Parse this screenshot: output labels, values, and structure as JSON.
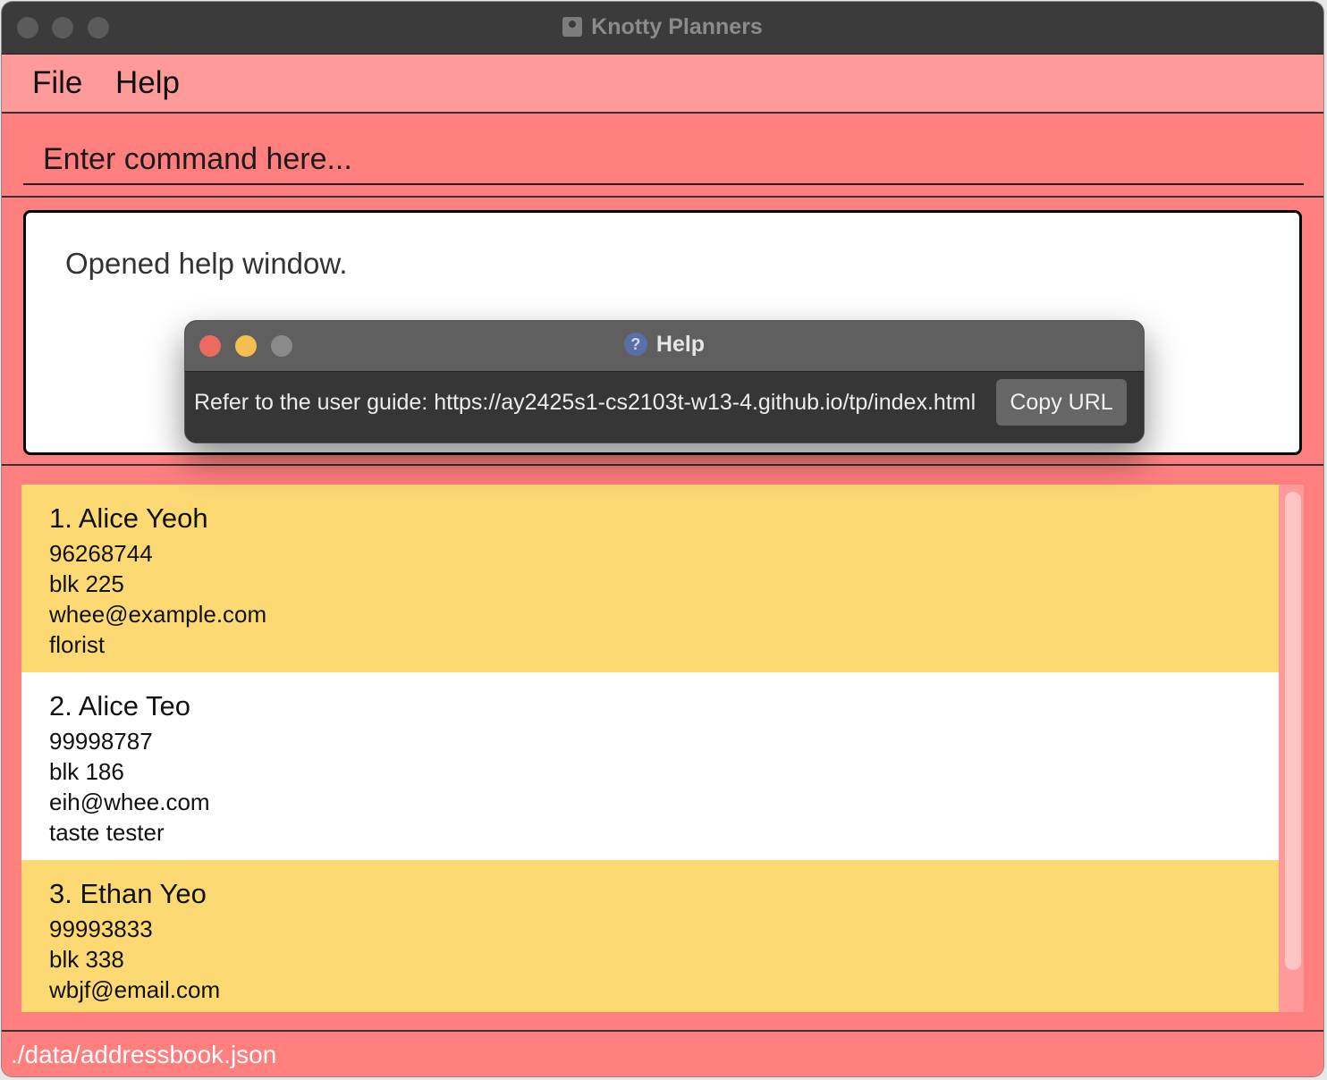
{
  "window": {
    "title": "Knotty Planners"
  },
  "menu": {
    "file": "File",
    "help": "Help"
  },
  "command": {
    "placeholder": "Enter command here..."
  },
  "result": {
    "text": "Opened help window."
  },
  "persons": [
    {
      "index_name": "1. Alice Yeoh",
      "phone": "96268744",
      "address": "blk 225",
      "email": "whee@example.com",
      "job": "florist"
    },
    {
      "index_name": "2. Alice Teo",
      "phone": "99998787",
      "address": "blk 186",
      "email": "eih@whee.com",
      "job": "taste tester"
    },
    {
      "index_name": "3. Ethan Yeo",
      "phone": "99993833",
      "address": "blk 338",
      "email": "wbjf@email.com",
      "job": ""
    }
  ],
  "status": {
    "path": "./data/addressbook.json"
  },
  "help_dialog": {
    "title": "Help",
    "message": "Refer to the user guide: https://ay2425s1-cs2103t-w13-4.github.io/tp/index.html",
    "copy_button": "Copy URL"
  },
  "colors": {
    "accent": "#ff7f7f",
    "menu_bg": "#ff9a9a",
    "card_yellow": "#fdd974",
    "card_white": "#ffffff",
    "close_dot": "#ec6a5e",
    "minimize_dot": "#f4bf4f",
    "zoom_dot_inactive": "#8a8a8a"
  }
}
